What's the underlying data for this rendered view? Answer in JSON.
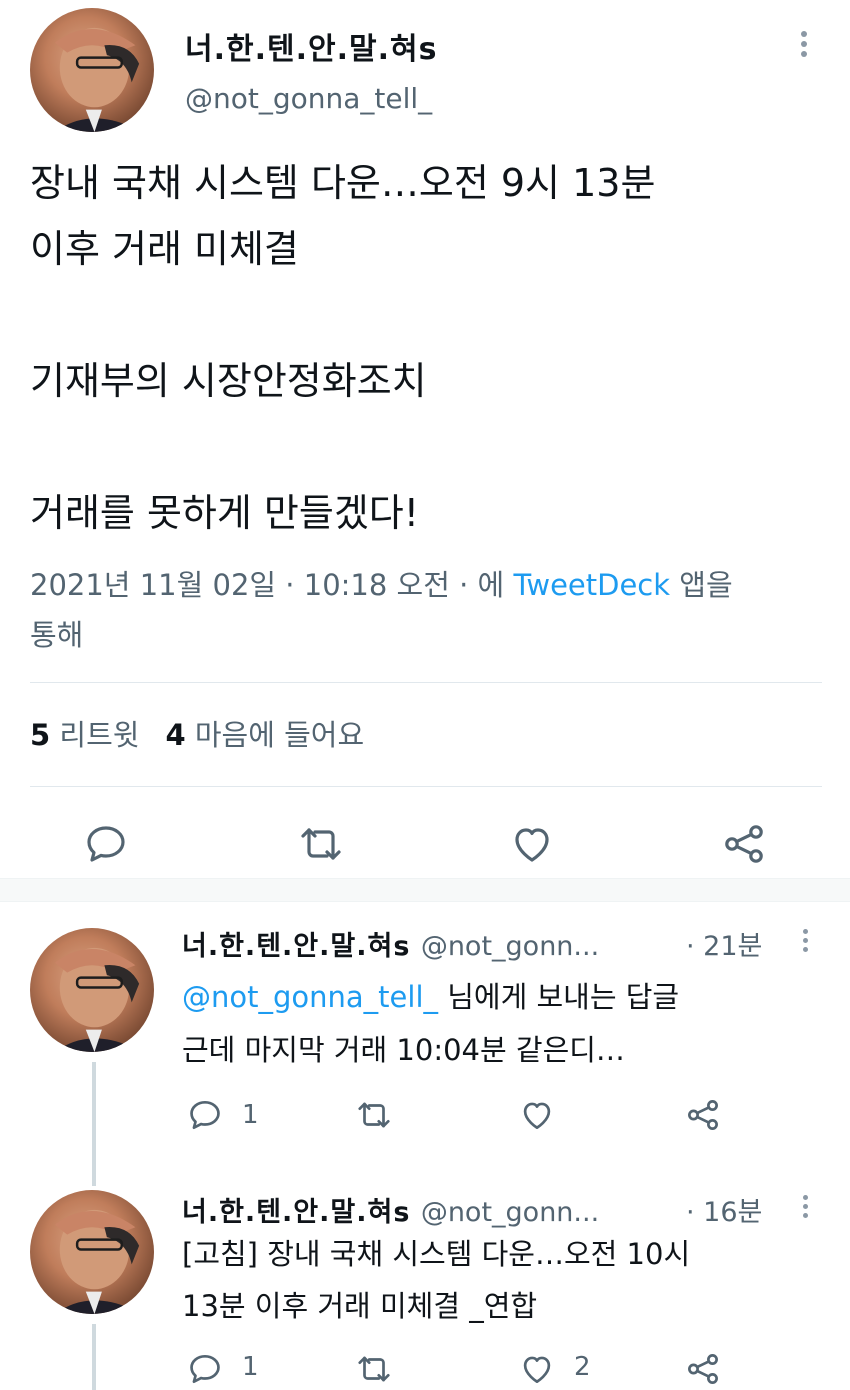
{
  "main_tweet": {
    "display_name": "너.한.텐.안.말.혀s",
    "handle": "@not_gonna_tell_",
    "body": "장내 국채 시스템 다운…오전 9시 13분\n이후 거래 미체결\n\n기재부의 시장안정화조치\n\n거래를 못하게 만들겠다!",
    "timestamp": "2021년 11월 02일 · 10:18 오전 · 에",
    "via_app": "TweetDeck",
    "via_suffix_1": " 앱을",
    "via_suffix_2": "통해",
    "retweet_count": "5",
    "retweet_label": "리트윗",
    "like_count": "4",
    "like_label": "마음에 들어요"
  },
  "replies": [
    {
      "display_name": "너.한.텐.안.말.혀s",
      "handle": "@not_gonn...",
      "time": "· 21분",
      "reply_to_mention": "@not_gonna_tell_",
      "reply_to_suffix": " 님에게 보내는 답글",
      "text": "근데 마지막 거래 10:04분 같은디…",
      "reply_count": "1",
      "retweet_count": "",
      "like_count": ""
    },
    {
      "display_name": "너.한.텐.안.말.혀s",
      "handle": "@not_gonn...",
      "time": "· 16분",
      "text": "[고침] 장내 국채 시스템 다운…오전 10시\n13분 이후 거래 미체결 _연합",
      "reply_count": "1",
      "retweet_count": "",
      "like_count": "2"
    }
  ],
  "colors": {
    "text": "#0f1419",
    "secondary": "#536471",
    "link": "#1d9bf0",
    "divider": "#e1e8ed"
  },
  "icons": [
    "reply-icon",
    "retweet-icon",
    "like-icon",
    "share-icon",
    "more-icon"
  ]
}
